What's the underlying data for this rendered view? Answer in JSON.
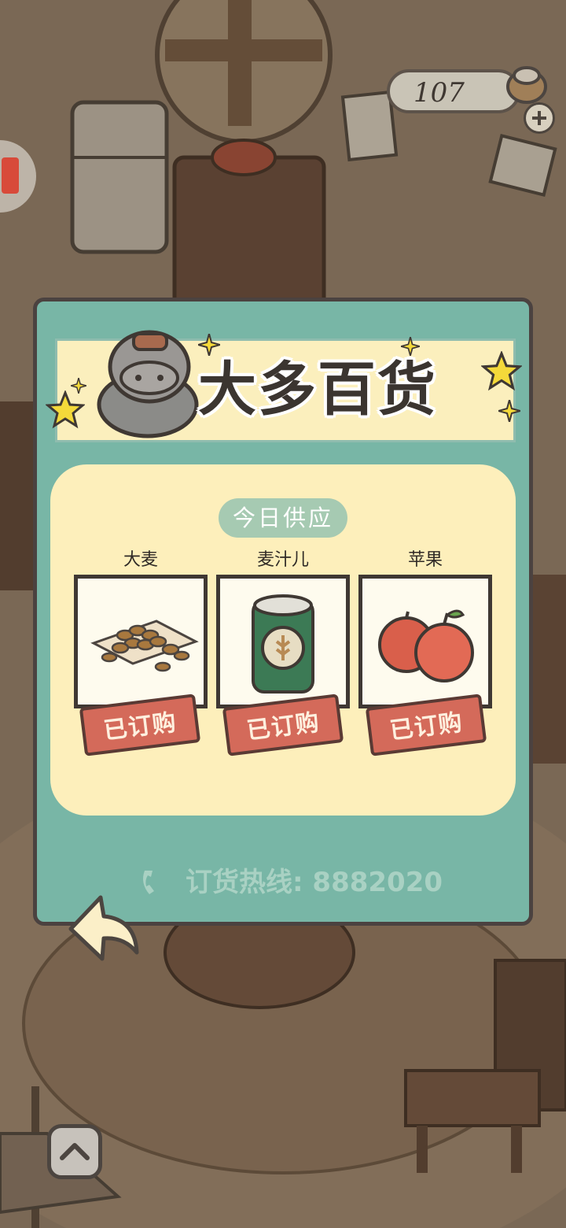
{
  "hud": {
    "coins": "107"
  },
  "shop": {
    "title": "大多百货",
    "supply_label": "今日供应",
    "items": [
      {
        "name": "大麦",
        "status": "已订购",
        "icon": "barley-icon"
      },
      {
        "name": "麦汁儿",
        "status": "已订购",
        "icon": "wort-can-icon"
      },
      {
        "name": "苹果",
        "status": "已订购",
        "icon": "apples-icon"
      }
    ],
    "hotline": "订货热线: 8882020"
  },
  "colors": {
    "panel": "#78b6a6",
    "banner": "#fbefbd",
    "inner_panel": "#fdefbb",
    "tag": "#d46a5a",
    "outline": "#4b4240"
  }
}
